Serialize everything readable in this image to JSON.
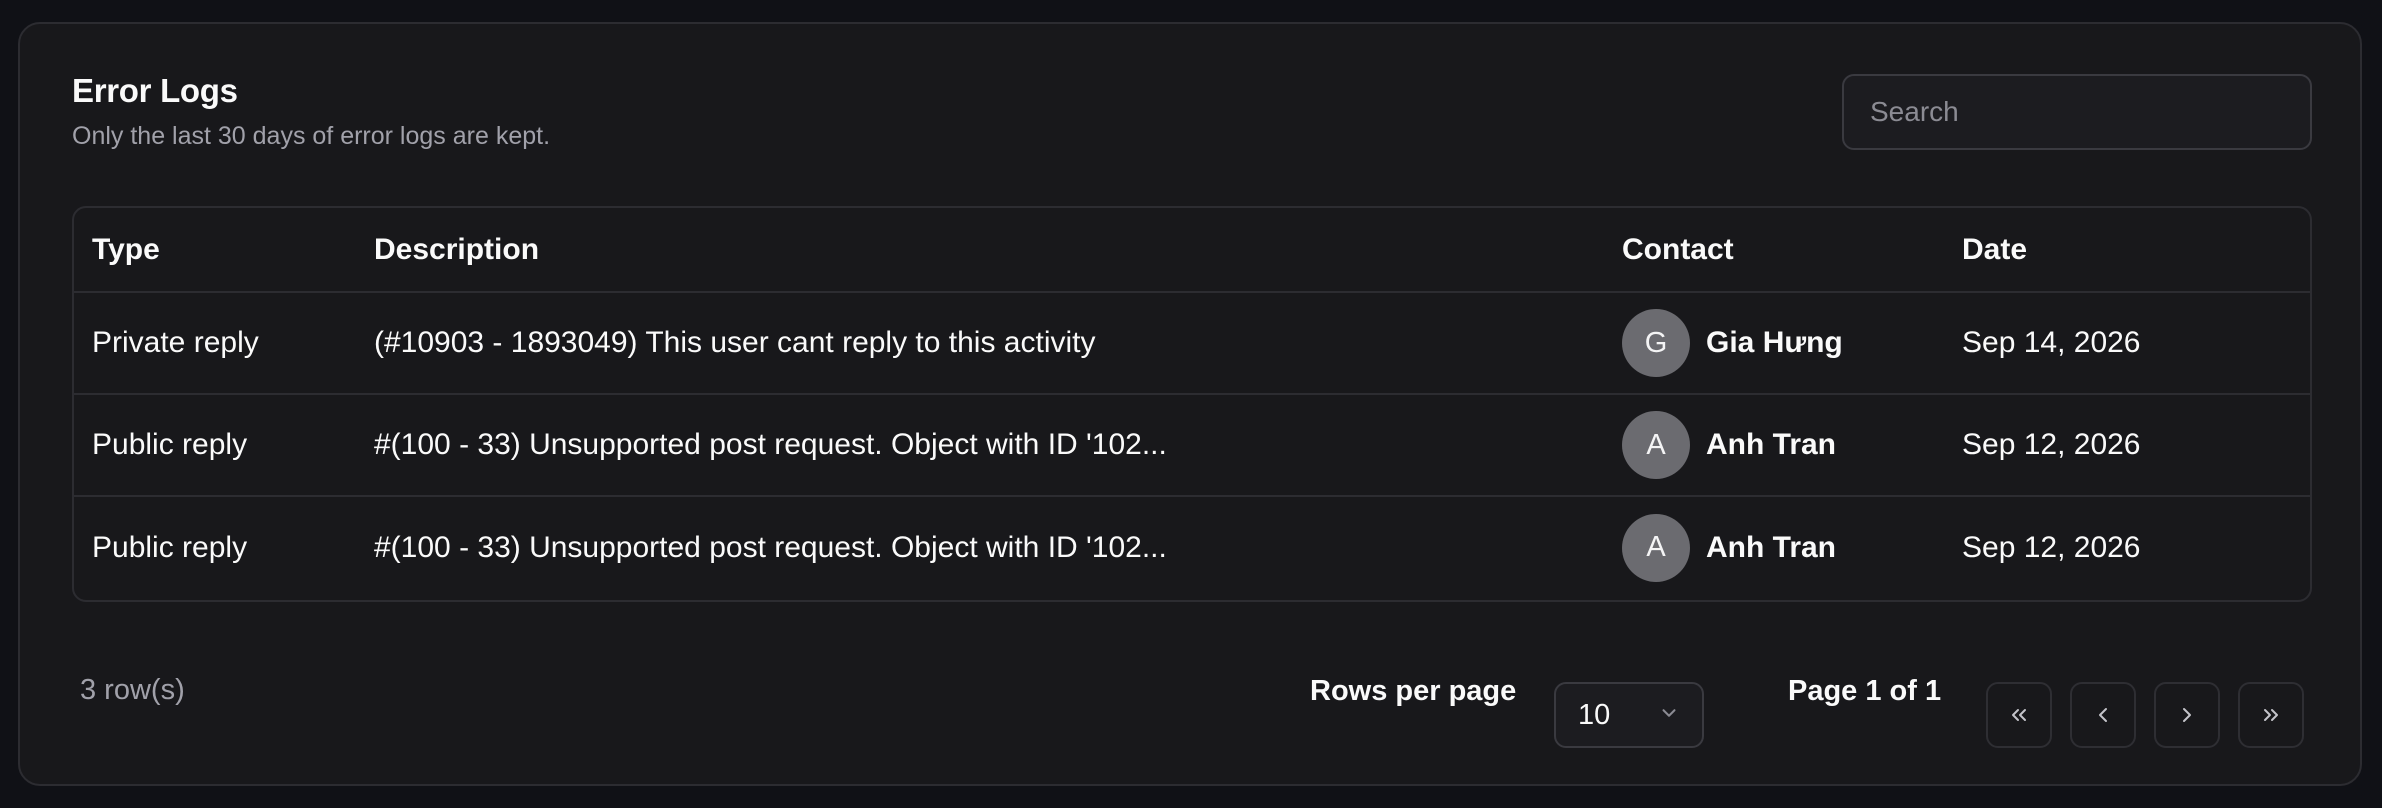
{
  "header": {
    "title": "Error Logs",
    "subtitle": "Only the last 30 days of error logs are kept."
  },
  "search": {
    "placeholder": "Search",
    "value": ""
  },
  "table": {
    "columns": [
      "Type",
      "Description",
      "Contact",
      "Date"
    ],
    "rows": [
      {
        "type": "Private reply",
        "description": "(#10903 - 1893049) This user cant reply to this activity",
        "contact": {
          "initial": "G",
          "name": "Gia Hưng"
        },
        "date": "Sep 14, 2026"
      },
      {
        "type": "Public reply",
        "description": "#(100 - 33) Unsupported post request. Object with ID '102...",
        "contact": {
          "initial": "A",
          "name": "Anh Tran"
        },
        "date": "Sep 12, 2026"
      },
      {
        "type": "Public reply",
        "description": "#(100 - 33) Unsupported post request. Object with ID '102...",
        "contact": {
          "initial": "A",
          "name": "Anh Tran"
        },
        "date": "Sep 12, 2026"
      }
    ]
  },
  "footer": {
    "row_count": "3 row(s)",
    "rows_per_page_label": "Rows per page",
    "rows_per_page_value": "10",
    "page_info": "Page 1 of 1"
  },
  "pagination_icons": {
    "first": "chevrons-left-icon",
    "prev": "chevron-left-icon",
    "next": "chevron-right-icon",
    "last": "chevrons-right-icon"
  },
  "colors": {
    "background": "#101116",
    "card": "#18181b",
    "border": "#2c2c31",
    "muted_text": "#a1a1aa",
    "avatar": "#6b6b70"
  }
}
